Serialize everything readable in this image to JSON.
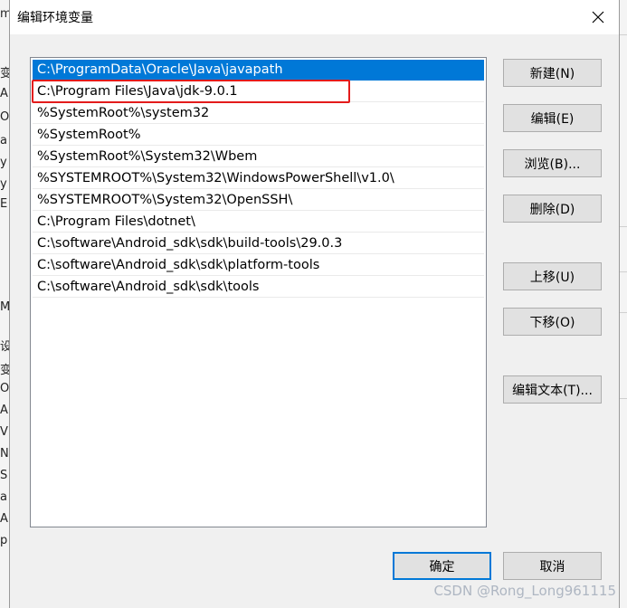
{
  "dialog": {
    "title": "编辑环境变量",
    "close_icon": "close-icon"
  },
  "paths": [
    "C:\\ProgramData\\Oracle\\Java\\javapath",
    "C:\\Program Files\\Java\\jdk-9.0.1",
    "%SystemRoot%\\system32",
    "%SystemRoot%",
    "%SystemRoot%\\System32\\Wbem",
    "%SYSTEMROOT%\\System32\\WindowsPowerShell\\v1.0\\",
    "%SYSTEMROOT%\\System32\\OpenSSH\\",
    "C:\\Program Files\\dotnet\\",
    "C:\\software\\Android_sdk\\sdk\\build-tools\\29.0.3",
    "C:\\software\\Android_sdk\\sdk\\platform-tools",
    "C:\\software\\Android_sdk\\sdk\\tools"
  ],
  "selected_index": 0,
  "highlighted_index": 1,
  "buttons": {
    "new": "新建(N)",
    "edit": "编辑(E)",
    "browse": "浏览(B)...",
    "delete": "删除(D)",
    "move_up": "上移(U)",
    "move_down": "下移(O)",
    "edit_text": "编辑文本(T)...",
    "ok": "确定",
    "cancel": "取消"
  },
  "watermark": "CSDN @Rong_Long961115",
  "background_fragments": [
    "m",
    "变",
    "A",
    "Or",
    "a",
    "y",
    "y",
    "E",
    "M",
    "设",
    "变",
    "Or",
    "A",
    "V",
    "NU",
    "S",
    "a",
    "A",
    "p"
  ],
  "colors": {
    "selection": "#0078d7",
    "highlight_box": "#e31b1b"
  }
}
